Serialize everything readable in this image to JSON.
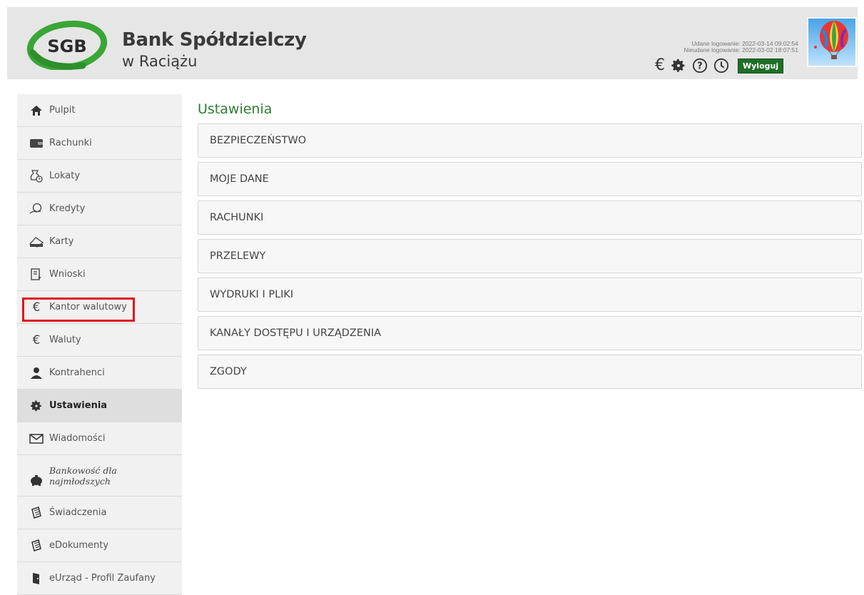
{
  "header": {
    "logo_text": "SGB",
    "bank_name": "Bank Spółdzielczy",
    "bank_location": "w Raciążu",
    "login_success": "Udane logowanie: 2022-03-14 09:02:54",
    "login_failed": "Nieudane logowanie: 2022-03-02 18:07:51",
    "logout_label": "Wyloguj",
    "icons": [
      "euro-icon",
      "gear-icon",
      "help-icon",
      "history-icon"
    ],
    "brand_green": "#1f6e28"
  },
  "sidebar": {
    "items": [
      {
        "label": "Pulpit",
        "icon": "home-icon",
        "active": false
      },
      {
        "label": "Rachunki",
        "icon": "wallet-icon",
        "active": false
      },
      {
        "label": "Lokaty",
        "icon": "deposit-icon",
        "active": false
      },
      {
        "label": "Kredyty",
        "icon": "loan-icon",
        "active": false
      },
      {
        "label": "Karty",
        "icon": "card-icon",
        "active": false
      },
      {
        "label": "Wnioski",
        "icon": "application-icon",
        "active": false
      },
      {
        "label": "Kantor walutowy",
        "icon": "euro-icon",
        "active": false,
        "highlighted": true
      },
      {
        "label": "Waluty",
        "icon": "euro-icon",
        "active": false
      },
      {
        "label": "Kontrahenci",
        "icon": "contacts-icon",
        "active": false
      },
      {
        "label": "Ustawienia",
        "icon": "gear-icon",
        "active": true
      },
      {
        "label": "Wiadomości",
        "icon": "envelope-icon",
        "active": false
      },
      {
        "label_line1": "Bankowość dla",
        "label_line2": "najmłodszych",
        "icon": "piggy-bank-icon",
        "active": false
      },
      {
        "label": "Świadczenia",
        "icon": "document-icon",
        "active": false
      },
      {
        "label": "eDokumenty",
        "icon": "document-icon",
        "active": false
      },
      {
        "label": "eUrząd - Profil Zaufany",
        "icon": "door-icon",
        "active": false
      }
    ],
    "highlight_color": "#e1141b"
  },
  "main": {
    "title": "Ustawienia",
    "title_color": "#2e7d32",
    "sections": [
      "BEZPIECZEŃSTWO",
      "MOJE DANE",
      "RACHUNKI",
      "PRZELEWY",
      "WYDRUKI I PLIKI",
      "KANAŁY DOSTĘPU I URZĄDZENIA",
      "ZGODY"
    ]
  }
}
